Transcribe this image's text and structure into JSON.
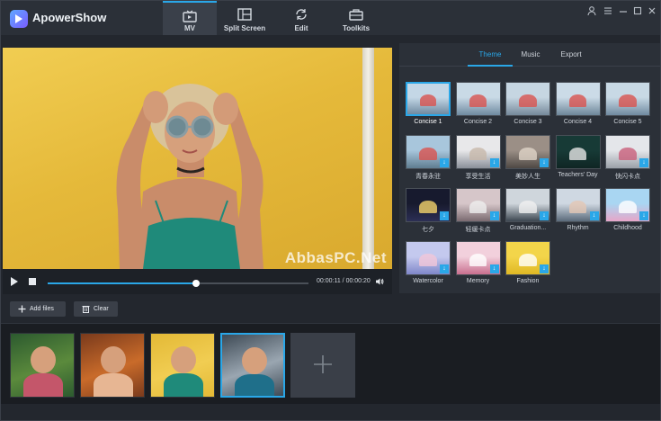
{
  "app": {
    "name": "ApowerShow"
  },
  "nav": {
    "tabs": [
      {
        "label": "MV",
        "icon": "tv-icon",
        "active": true
      },
      {
        "label": "Split Screen",
        "icon": "split-screen-icon",
        "active": false
      },
      {
        "label": "Edit",
        "icon": "refresh-icon",
        "active": false
      },
      {
        "label": "Toolkits",
        "icon": "toolbox-icon",
        "active": false
      }
    ]
  },
  "window_controls": {
    "user": "user-icon",
    "menu": "menu-icon",
    "minimize": "minimize-icon",
    "maximize": "maximize-icon",
    "close": "close-icon"
  },
  "preview": {
    "watermark": "AbbasPC.Net",
    "time": "00:00:11 / 00:00:20",
    "progress": 0.57
  },
  "panel": {
    "tabs": [
      {
        "label": "Theme",
        "active": true
      },
      {
        "label": "Music",
        "active": false
      },
      {
        "label": "Export",
        "active": false
      }
    ],
    "themes": [
      {
        "label": "Concise 1",
        "selected": true,
        "download": false,
        "colors": [
          "#c4d7e6",
          "#6f8aa0",
          "#d9534f"
        ]
      },
      {
        "label": "Concise 2",
        "selected": false,
        "download": false,
        "colors": [
          "#c9dae6",
          "#6f8aa0",
          "#d9534f"
        ]
      },
      {
        "label": "Concise 3",
        "selected": false,
        "download": false,
        "colors": [
          "#c6d6e2",
          "#75899a",
          "#d9534f"
        ]
      },
      {
        "label": "Concise 4",
        "selected": false,
        "download": false,
        "colors": [
          "#cbdbe7",
          "#6d8699",
          "#d9534f"
        ]
      },
      {
        "label": "Concise 5",
        "selected": false,
        "download": false,
        "colors": [
          "#c8d9e5",
          "#708aa0",
          "#d9534f"
        ]
      },
      {
        "label": "青春永驻",
        "selected": false,
        "download": true,
        "colors": [
          "#a8c6dc",
          "#5f7d91",
          "#d9534f"
        ]
      },
      {
        "label": "享受生活",
        "selected": false,
        "download": true,
        "colors": [
          "#e8e8ea",
          "#8a8f99",
          "#c7b8aa"
        ]
      },
      {
        "label": "美妙人生",
        "selected": false,
        "download": true,
        "colors": [
          "#9b8f86",
          "#4e4844",
          "#e0d4c8"
        ]
      },
      {
        "label": "Teachers' Day",
        "selected": false,
        "download": false,
        "colors": [
          "#173a36",
          "#0f2624",
          "#e6e6e6"
        ]
      },
      {
        "label": "快闪卡点",
        "selected": false,
        "download": true,
        "colors": [
          "#e4e6ea",
          "#9aa0a8",
          "#c95f7a"
        ]
      },
      {
        "label": "七夕",
        "selected": false,
        "download": true,
        "colors": [
          "#171a2e",
          "#2c2f55",
          "#f4d36b"
        ]
      },
      {
        "label": "轻缓卡点",
        "selected": false,
        "download": true,
        "colors": [
          "#d6c6c9",
          "#7a6a70",
          "#eeeeee"
        ]
      },
      {
        "label": "Graduation...",
        "selected": false,
        "download": true,
        "colors": [
          "#cfd6dc",
          "#3c4650",
          "#f0f0f0"
        ]
      },
      {
        "label": "Rhythm",
        "selected": false,
        "download": true,
        "colors": [
          "#cfd8e2",
          "#5a6a7a",
          "#e3c7b4"
        ]
      },
      {
        "label": "Childhood",
        "selected": false,
        "download": true,
        "colors": [
          "#a9d6f2",
          "#e7a6c9",
          "#ffffff"
        ]
      },
      {
        "label": "Watercolor",
        "selected": false,
        "download": true,
        "colors": [
          "#c4c9ee",
          "#7f86c9",
          "#f2c7d8"
        ]
      },
      {
        "label": "Memory",
        "selected": false,
        "download": true,
        "colors": [
          "#f2d0dc",
          "#c96f8e",
          "#ffffff"
        ]
      },
      {
        "label": "Fashion",
        "selected": false,
        "download": true,
        "colors": [
          "#f3d54a",
          "#e0b824",
          "#ffffff"
        ]
      }
    ]
  },
  "actions": {
    "add_files": "Add files",
    "clear": "Clear"
  },
  "media": [
    {
      "selected": false,
      "colors": [
        "#2c5a2f",
        "#5b8a3c",
        "#c4566a"
      ]
    },
    {
      "selected": false,
      "colors": [
        "#7a3a1c",
        "#c96b2a",
        "#e7b693"
      ]
    },
    {
      "selected": false,
      "colors": [
        "#e3b936",
        "#f1cd52",
        "#1f8a7a"
      ]
    },
    {
      "selected": true,
      "colors": [
        "#3e4a55",
        "#9aa6b1",
        "#1f6f8a"
      ]
    }
  ],
  "colors": {
    "accent": "#2aa7e8"
  }
}
